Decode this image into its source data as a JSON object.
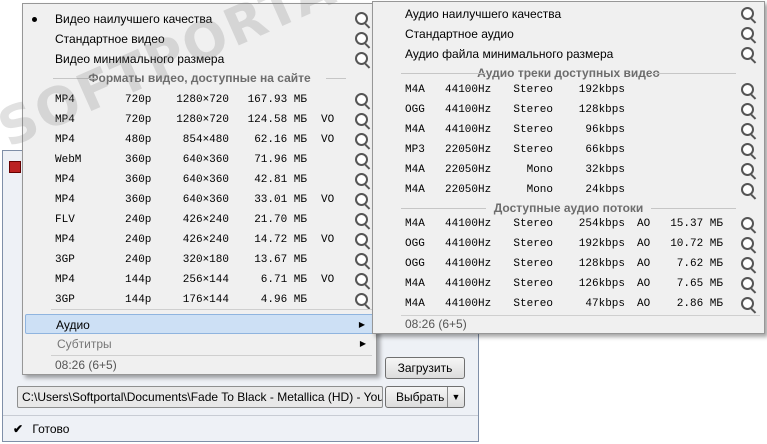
{
  "window": {
    "download_label": "Загрузить",
    "path_value": "C:\\Users\\Softportal\\Documents\\Fade To Black - Metallica (HD) - YouT...",
    "select_label": "Выбрать",
    "status_text": "Готово"
  },
  "watermark": {
    "text": "SOFTPORTAL"
  },
  "video_menu": {
    "presets": [
      {
        "label": "Видео наилучшего качества"
      },
      {
        "label": "Стандартное видео"
      },
      {
        "label": "Видео минимального размера"
      }
    ],
    "section_title": "Форматы видео, доступные на сайте",
    "formats": [
      {
        "container": "MP4",
        "quality": "720p",
        "resolution": "1280×720",
        "size": "167.93 МБ",
        "flag": ""
      },
      {
        "container": "MP4",
        "quality": "720p",
        "resolution": "1280×720",
        "size": "124.58 МБ",
        "flag": "VO"
      },
      {
        "container": "MP4",
        "quality": "480p",
        "resolution": "854×480",
        "size": "62.16 МБ",
        "flag": "VO"
      },
      {
        "container": "WebM",
        "quality": "360p",
        "resolution": "640×360",
        "size": "71.96 МБ",
        "flag": ""
      },
      {
        "container": "MP4",
        "quality": "360p",
        "resolution": "640×360",
        "size": "42.81 МБ",
        "flag": ""
      },
      {
        "container": "MP4",
        "quality": "360p",
        "resolution": "640×360",
        "size": "33.01 МБ",
        "flag": "VO"
      },
      {
        "container": "FLV",
        "quality": "240p",
        "resolution": "426×240",
        "size": "21.70 МБ",
        "flag": ""
      },
      {
        "container": "MP4",
        "quality": "240p",
        "resolution": "426×240",
        "size": "14.72 МБ",
        "flag": "VO"
      },
      {
        "container": "3GP",
        "quality": "240p",
        "resolution": "320×180",
        "size": "13.67 МБ",
        "flag": ""
      },
      {
        "container": "MP4",
        "quality": "144p",
        "resolution": "256×144",
        "size": "6.71 МБ",
        "flag": "VO"
      },
      {
        "container": "3GP",
        "quality": "144p",
        "resolution": "176×144",
        "size": "4.96 МБ",
        "flag": ""
      }
    ],
    "audio_label": "Аудио",
    "subtitles_label": "Субтитры",
    "duration": "08:26 (6+5)"
  },
  "audio_menu": {
    "presets": [
      {
        "label": "Аудио наилучшего качества"
      },
      {
        "label": "Стандартное аудио"
      },
      {
        "label": "Аудио файла минимального размера"
      }
    ],
    "tracks_title": "Аудио треки доступных видео",
    "tracks": [
      {
        "codec": "M4A",
        "rate": "44100Hz",
        "channels": "Stereo",
        "bitrate": "192kbps"
      },
      {
        "codec": "OGG",
        "rate": "44100Hz",
        "channels": "Stereo",
        "bitrate": "128kbps"
      },
      {
        "codec": "M4A",
        "rate": "44100Hz",
        "channels": "Stereo",
        "bitrate": "96kbps"
      },
      {
        "codec": "MP3",
        "rate": "22050Hz",
        "channels": "Stereo",
        "bitrate": "66kbps"
      },
      {
        "codec": "M4A",
        "rate": "22050Hz",
        "channels": "Mono",
        "bitrate": "32kbps"
      },
      {
        "codec": "M4A",
        "rate": "22050Hz",
        "channels": "Mono",
        "bitrate": "24kbps"
      }
    ],
    "streams_title": "Доступные аудио потоки",
    "streams": [
      {
        "codec": "M4A",
        "rate": "44100Hz",
        "channels": "Stereo",
        "bitrate": "254kbps",
        "flag": "AO",
        "size": "15.37 МБ"
      },
      {
        "codec": "OGG",
        "rate": "44100Hz",
        "channels": "Stereo",
        "bitrate": "192kbps",
        "flag": "AO",
        "size": "10.72 МБ"
      },
      {
        "codec": "OGG",
        "rate": "44100Hz",
        "channels": "Stereo",
        "bitrate": "128kbps",
        "flag": "AO",
        "size": "7.62 МБ"
      },
      {
        "codec": "M4A",
        "rate": "44100Hz",
        "channels": "Stereo",
        "bitrate": "126kbps",
        "flag": "AO",
        "size": "7.65 МБ"
      },
      {
        "codec": "M4A",
        "rate": "44100Hz",
        "channels": "Stereo",
        "bitrate": "47kbps",
        "flag": "AO",
        "size": "2.86 МБ"
      }
    ],
    "duration": "08:26 (6+5)"
  }
}
